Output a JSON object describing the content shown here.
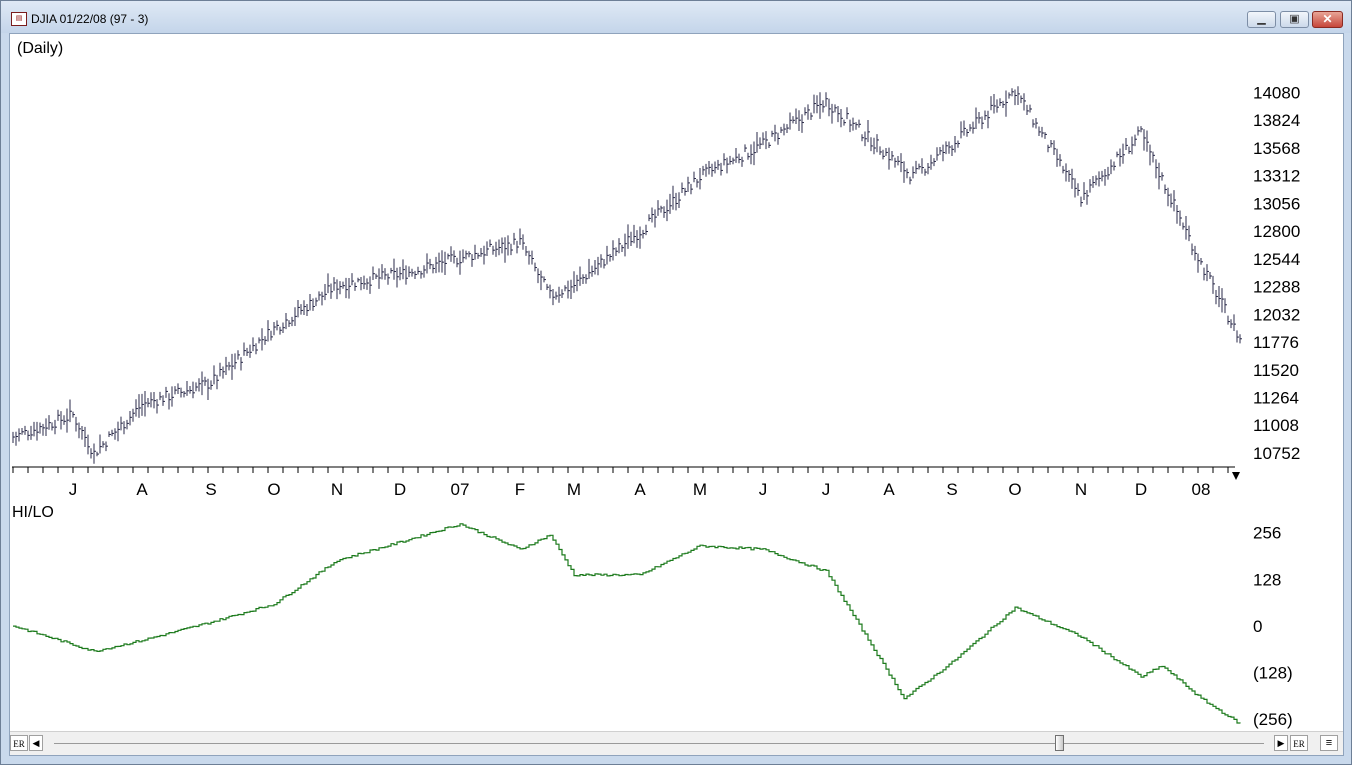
{
  "window": {
    "title": "DJIA 01/22/08 (97 - 3)",
    "app_icon": "chart-app-icon",
    "buttons": {
      "minimize": "minimize-icon",
      "maximize": "maximize-icon",
      "close": "close-icon"
    }
  },
  "colors": {
    "price_bars": "#2a2a48",
    "indicator_line": "#1c7a1c",
    "window_frame": "#c9d9ec"
  },
  "chart_data": [
    {
      "type": "bar",
      "subtype": "ohlc",
      "title": "(Daily)",
      "y_tick_labels": [
        "14080",
        "13824",
        "13568",
        "13312",
        "13056",
        "12800",
        "12544",
        "12288",
        "12032",
        "11776",
        "11520",
        "11264",
        "11008",
        "10752"
      ],
      "ylim": [
        10650,
        14250
      ],
      "x_tick_labels": [
        "J",
        "A",
        "S",
        "O",
        "N",
        "D",
        "07",
        "F",
        "M",
        "A",
        "M",
        "J",
        "J",
        "A",
        "S",
        "O",
        "N",
        "D",
        "08"
      ],
      "approx_close_path": [
        [
          "Jun-06",
          10900
        ],
        [
          "Jul-06",
          11100
        ],
        [
          "Jul-06 low",
          10750
        ],
        [
          "Aug-06",
          11200
        ],
        [
          "Sep-06",
          11400
        ],
        [
          "Oct-06",
          11900
        ],
        [
          "Nov-06",
          12300
        ],
        [
          "Dec-06",
          12400
        ],
        [
          "Jan-07",
          12550
        ],
        [
          "Feb-07",
          12700
        ],
        [
          "Feb-27-07",
          12200
        ],
        [
          "Mar-07",
          12300
        ],
        [
          "Apr-07",
          12800
        ],
        [
          "May-07",
          13300
        ],
        [
          "Jun-07",
          13600
        ],
        [
          "Jul-07",
          14000
        ],
        [
          "Aug-07",
          13300
        ],
        [
          "Sep-07",
          13600
        ],
        [
          "Oct-07",
          14100
        ],
        [
          "Nov-07",
          13100
        ],
        [
          "Dec-07",
          13700
        ],
        [
          "Jan-08",
          12500
        ],
        [
          "Jan-22-08",
          11800
        ]
      ]
    },
    {
      "type": "line",
      "title": "HI/LO",
      "y_tick_labels": [
        "256",
        "128",
        "0",
        "(128)",
        "(256)"
      ],
      "ylim": [
        -270,
        280
      ],
      "approx_values": [
        [
          "start",
          0
        ],
        [
          "Jul-06",
          -70
        ],
        [
          "Aug-06",
          -40
        ],
        [
          "Sep-06",
          10
        ],
        [
          "Oct-06",
          60
        ],
        [
          "Nov-06",
          180
        ],
        [
          "Dec-06",
          230
        ],
        [
          "Jan-07",
          280
        ],
        [
          "Feb-07",
          210
        ],
        [
          "Feb-27-07",
          250
        ],
        [
          "Mar-07",
          140
        ],
        [
          "Apr-07",
          140
        ],
        [
          "May-07",
          220
        ],
        [
          "Jun-07",
          210
        ],
        [
          "Jul-07",
          150
        ],
        [
          "Aug-16-07",
          -200
        ],
        [
          "Sep-07",
          -100
        ],
        [
          "Oct-07",
          50
        ],
        [
          "Nov-07",
          -30
        ],
        [
          "Dec-07",
          -140
        ],
        [
          "Dec-20-07",
          -110
        ],
        [
          "Jan-08",
          -200
        ],
        [
          "Jan-22-08",
          -270
        ]
      ]
    }
  ],
  "scrollbar": {
    "left_label": "ER",
    "right_label": "ER",
    "position": 0.83
  }
}
